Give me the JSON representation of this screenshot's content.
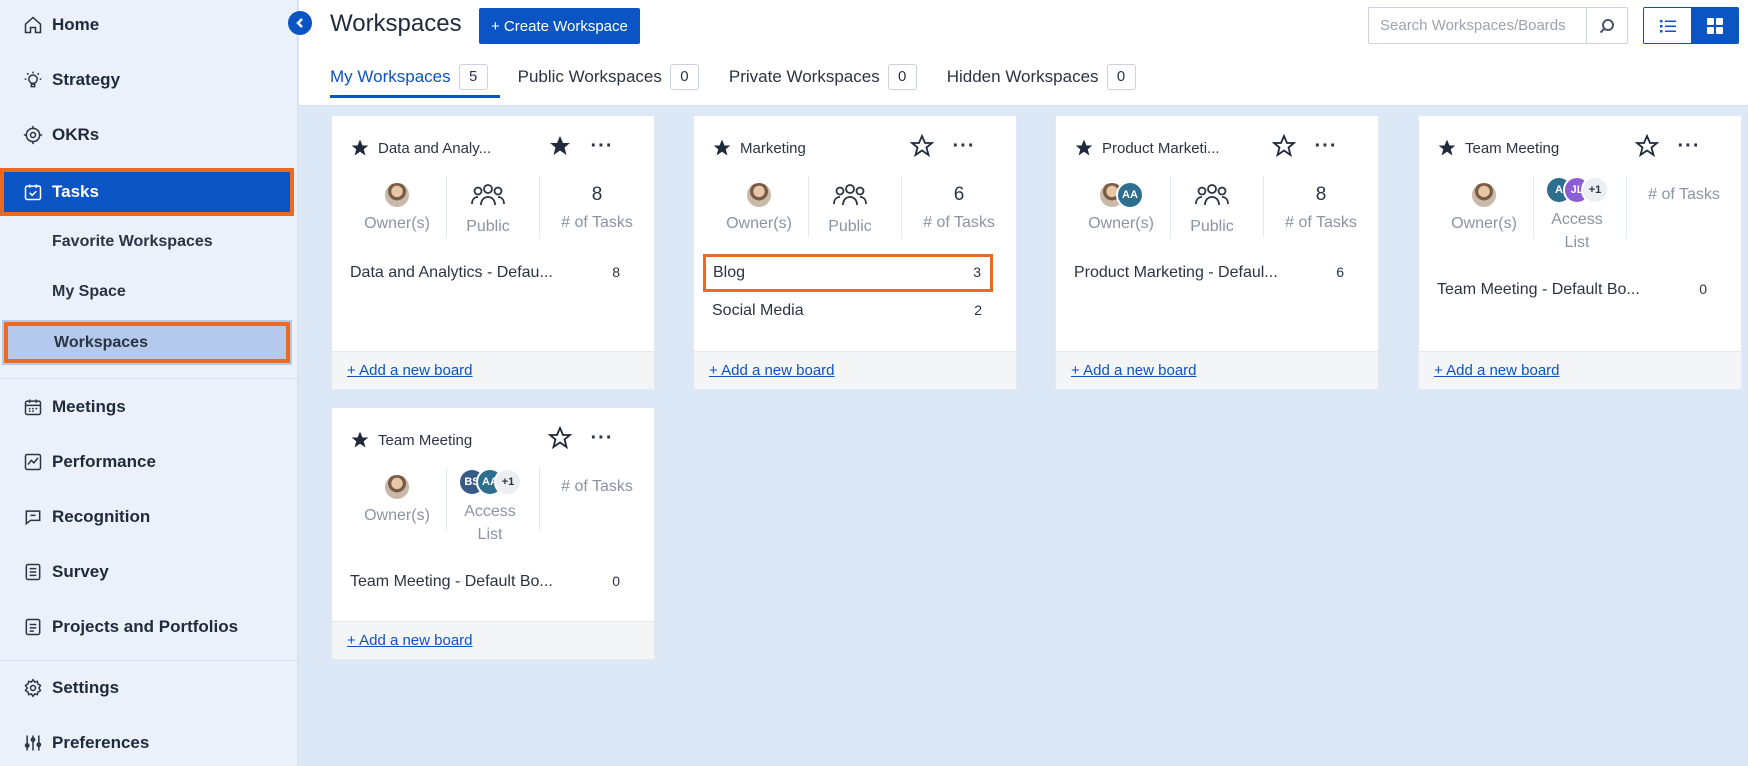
{
  "sidebar": {
    "nav": [
      {
        "label": "Home",
        "icon": "home-icon"
      },
      {
        "label": "Strategy",
        "icon": "lightbulb-icon"
      },
      {
        "label": "OKRs",
        "icon": "target-icon"
      },
      {
        "label": "Tasks",
        "icon": "task-calendar-icon"
      },
      {
        "label": "Meetings",
        "icon": "calendar-icon"
      },
      {
        "label": "Performance",
        "icon": "chart-icon"
      },
      {
        "label": "Recognition",
        "icon": "chat-icon"
      },
      {
        "label": "Survey",
        "icon": "list-icon"
      },
      {
        "label": "Projects and Portfolios",
        "icon": "document-icon"
      },
      {
        "label": "Settings",
        "icon": "gear-icon"
      },
      {
        "label": "Preferences",
        "icon": "sliders-icon"
      }
    ],
    "sub_items": [
      {
        "label": "Favorite Workspaces"
      },
      {
        "label": "My Space"
      },
      {
        "label": "Workspaces"
      }
    ]
  },
  "header": {
    "title": "Workspaces",
    "create_label": "+ Create Workspace",
    "search_placeholder": "Search Workspaces/Boards",
    "tabs": [
      {
        "label": "My Workspaces",
        "count": "5"
      },
      {
        "label": "Public Workspaces",
        "count": "0"
      },
      {
        "label": "Private Workspaces",
        "count": "0"
      },
      {
        "label": "Hidden Workspaces",
        "count": "0"
      }
    ]
  },
  "labels": {
    "owners": "Owner(s)",
    "public": "Public",
    "tasks": "# of Tasks",
    "access": "Access",
    "list": "List",
    "add_board": "+ Add a new board"
  },
  "cards": [
    {
      "title": "Data and Analy...",
      "tasks": "8",
      "boards": [
        {
          "name": "Data and Analytics - Defau...",
          "count": "8"
        }
      ]
    },
    {
      "title": "Marketing",
      "tasks": "6",
      "boards": [
        {
          "name": "Blog",
          "count": "3"
        },
        {
          "name": "Social Media",
          "count": "2"
        }
      ]
    },
    {
      "title": "Product Marketi...",
      "tasks": "8",
      "owner_badge": "AA",
      "boards": [
        {
          "name": "Product Marketing - Defaul...",
          "count": "6"
        }
      ]
    },
    {
      "title": "Team Meeting",
      "access": [
        "A",
        "JL",
        "+1"
      ],
      "boards": [
        {
          "name": "Team Meeting - Default Bo...",
          "count": "0"
        }
      ]
    },
    {
      "title": "Team Meeting",
      "access": [
        "BS",
        "AA",
        "+1"
      ],
      "boards": [
        {
          "name": "Team Meeting - Default Bo...",
          "count": "0"
        }
      ]
    }
  ],
  "colors": {
    "accent": "#0b54c4",
    "highlight": "#ee6a1f"
  }
}
